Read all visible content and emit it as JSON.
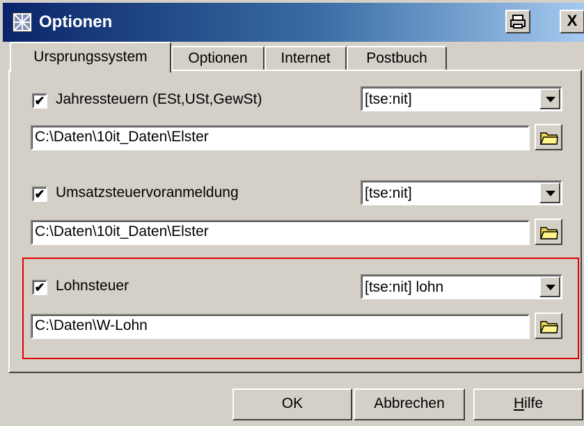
{
  "window": {
    "title": "Optionen",
    "print_icon": "printer-icon",
    "close_label": "X"
  },
  "tabs": [
    {
      "label": "Ursprungssystem",
      "active": true
    },
    {
      "label": "Optionen",
      "active": false
    },
    {
      "label": "Internet",
      "active": false
    },
    {
      "label": "Postbuch",
      "active": false
    }
  ],
  "sections": [
    {
      "checked": true,
      "checkbox_label": "Jahressteuern (ESt,USt,GewSt)",
      "combo_value": "[tse:nit]",
      "path": "C:\\Daten\\10it_Daten\\Elster"
    },
    {
      "checked": true,
      "checkbox_label": "Umsatzsteuervoranmeldung",
      "combo_value": "[tse:nit]",
      "path": "C:\\Daten\\10it_Daten\\Elster"
    },
    {
      "checked": true,
      "checkbox_label": "Lohnsteuer",
      "combo_value": "[tse:nit] lohn",
      "path": "C:\\Daten\\W-Lohn"
    }
  ],
  "buttons": {
    "ok": "OK",
    "cancel": "Abbrechen",
    "help_first": "H",
    "help_rest": "ilfe"
  },
  "check_mark": "✔",
  "colors": {
    "highlight": "#e00000",
    "title_gradient_start": "#0a246a",
    "folder_yellow": "#f0d84a"
  }
}
